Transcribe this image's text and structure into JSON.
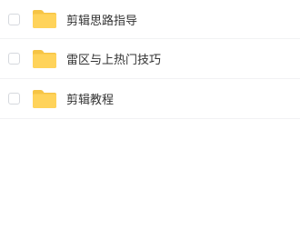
{
  "colors": {
    "folder": "#ffd35a",
    "folder_tab": "#f6c445",
    "text": "#333333",
    "divider": "#f1f2f4",
    "checkbox_border": "#d6d9de"
  },
  "file_list": {
    "items": [
      {
        "name": "剪辑思路指导",
        "icon": "folder-icon",
        "checked": false
      },
      {
        "name": "雷区与上热门技巧",
        "icon": "folder-icon",
        "checked": false
      },
      {
        "name": "剪辑教程",
        "icon": "folder-icon",
        "checked": false
      }
    ]
  }
}
